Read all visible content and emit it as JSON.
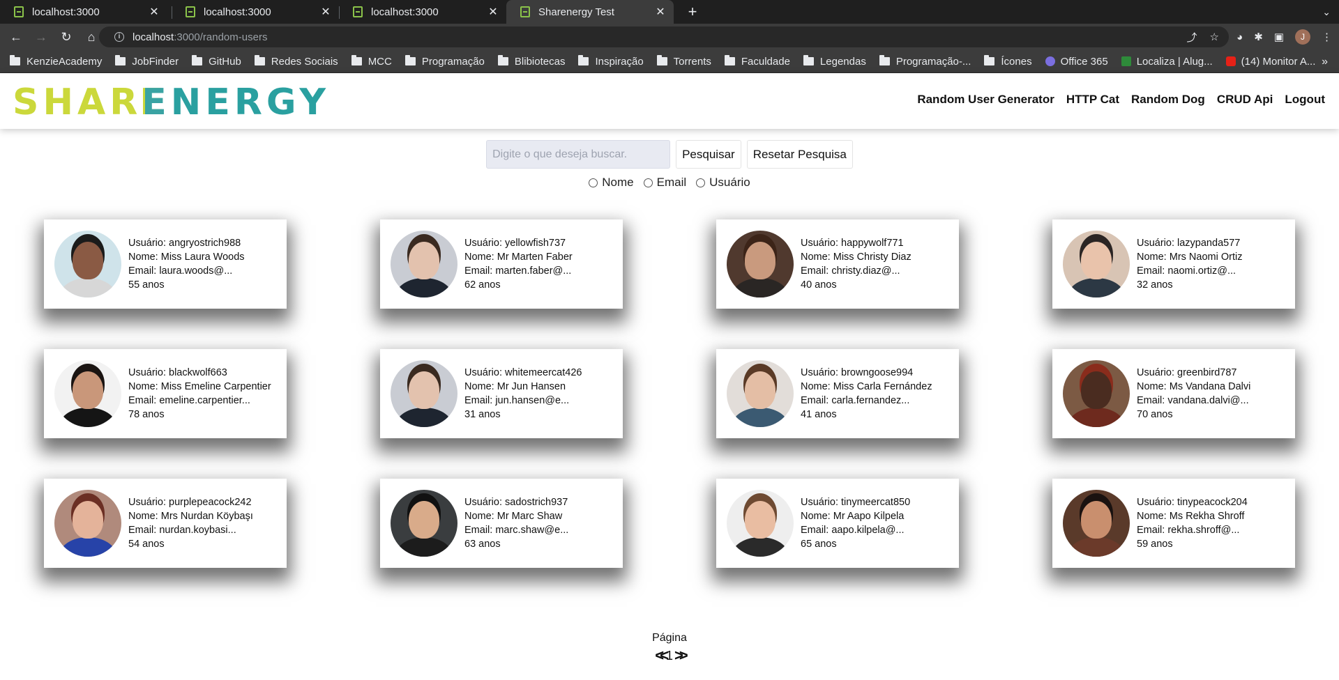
{
  "browser": {
    "tabs": [
      {
        "title": "localhost:3000",
        "active": false
      },
      {
        "title": "localhost:3000",
        "active": false
      },
      {
        "title": "localhost:3000",
        "active": false
      },
      {
        "title": "Sharenergy Test",
        "active": true
      }
    ],
    "url_host": "localhost",
    "url_path": ":3000/random-users",
    "bookmarks": [
      "KenzieAcademy",
      "JobFinder",
      "GitHub",
      "Redes Sociais",
      "MCC",
      "Programação",
      "Blibiotecas",
      "Inspiração",
      "Torrents",
      "Faculdade",
      "Legendas",
      "Programação-...",
      "Ícones",
      "Office 365",
      "Localiza | Alug...",
      "(14) Monitor A..."
    ],
    "profile_initial": "J"
  },
  "header": {
    "logo_share": "SHAR",
    "logo_e": "E",
    "logo_nergy": "NERGY",
    "nav": [
      "Random User Generator",
      "HTTP Cat",
      "Random Dog",
      "CRUD Api",
      "Logout"
    ]
  },
  "search": {
    "placeholder": "Digite o que deseja buscar.",
    "search_button": "Pesquisar",
    "reset_button": "Resetar Pesquisa",
    "filters": [
      "Nome",
      "Email",
      "Usuário"
    ]
  },
  "users": [
    {
      "username": "Usuário: angryostrich988",
      "name": "Nome: Miss Laura Woods",
      "email": "Email: laura.woods@...",
      "age": "55 anos",
      "skin": "#8a5a44",
      "hair": "#1b1b1b",
      "shirt": "#d7d7d7",
      "bg": "#cfe3ea"
    },
    {
      "username": "Usuário: yellowfish737",
      "name": "Nome: Mr Marten Faber",
      "email": "Email: marten.faber@...",
      "age": "62 anos",
      "skin": "#e3c2ae",
      "hair": "#3a2a20",
      "shirt": "#1e2530",
      "bg": "#c9ccd3"
    },
    {
      "username": "Usuário: happywolf771",
      "name": "Nome: Miss Christy Diaz",
      "email": "Email: christy.diaz@...",
      "age": "40 anos",
      "skin": "#c99a7e",
      "hair": "#3c2418",
      "shirt": "#2a2624",
      "bg": "#50392e"
    },
    {
      "username": "Usuário: lazypanda577",
      "name": "Nome: Mrs Naomi Ortiz",
      "email": "Email: naomi.ortiz@...",
      "age": "32 anos",
      "skin": "#e9c3ab",
      "hair": "#2b2524",
      "shirt": "#2c3844",
      "bg": "#d8c4b4"
    },
    {
      "username": "Usuário: blackwolf663",
      "name": "Nome: Miss Emeline Carpentier",
      "email": "Email: emeline.carpentier...",
      "age": "78 anos",
      "skin": "#c9977a",
      "hair": "#1a1412",
      "shirt": "#151515",
      "bg": "#f2f2f2"
    },
    {
      "username": "Usuário: whitemeercat426",
      "name": "Nome: Mr Jun Hansen",
      "email": "Email: jun.hansen@e...",
      "age": "31 anos",
      "skin": "#e3c2ae",
      "hair": "#3a2a20",
      "shirt": "#1e2530",
      "bg": "#c9ccd3"
    },
    {
      "username": "Usuário: browngoose994",
      "name": "Nome: Miss Carla Fernández",
      "email": "Email: carla.fernandez...",
      "age": "41 anos",
      "skin": "#e4bea5",
      "hair": "#5a3a26",
      "shirt": "#3b5a72",
      "bg": "#e2ddd9"
    },
    {
      "username": "Usuário: greenbird787",
      "name": "Nome: Ms Vandana Dalvi",
      "email": "Email: vandana.dalvi@...",
      "age": "70 anos",
      "skin": "#4a2c20",
      "hair": "#8a2c1c",
      "shirt": "#6e2a1e",
      "bg": "#7c5a44"
    },
    {
      "username": "Usuário: purplepeacock242",
      "name": "Nome: Mrs Nurdan Köybaşı",
      "email": "Email: nurdan.koybasi...",
      "age": "54 anos",
      "skin": "#e4b39a",
      "hair": "#6b2f24",
      "shirt": "#2743a8",
      "bg": "#b08a7c"
    },
    {
      "username": "Usuário: sadostrich937",
      "name": "Nome: Mr Marc Shaw",
      "email": "Email: marc.shaw@e...",
      "age": "63 anos",
      "skin": "#d9ab8a",
      "hair": "#111111",
      "shirt": "#1c1c1c",
      "bg": "#3a3d3f"
    },
    {
      "username": "Usuário: tinymeercat850",
      "name": "Nome: Mr Aapo Kilpela",
      "email": "Email: aapo.kilpela@...",
      "age": "65 anos",
      "skin": "#e9bda2",
      "hair": "#6e4a32",
      "shirt": "#2a2a2a",
      "bg": "#eeeeee"
    },
    {
      "username": "Usuário: tinypeacock204",
      "name": "Nome: Ms Rekha Shroff",
      "email": "Email: rekha.shroff@...",
      "age": "59 anos",
      "skin": "#c98f6e",
      "hair": "#1a1210",
      "shirt": "#6b3a2a",
      "bg": "#5a3a2a"
    }
  ],
  "pagination": {
    "label": "Página",
    "prev": "<<",
    "page": "1",
    "next": ">>"
  }
}
